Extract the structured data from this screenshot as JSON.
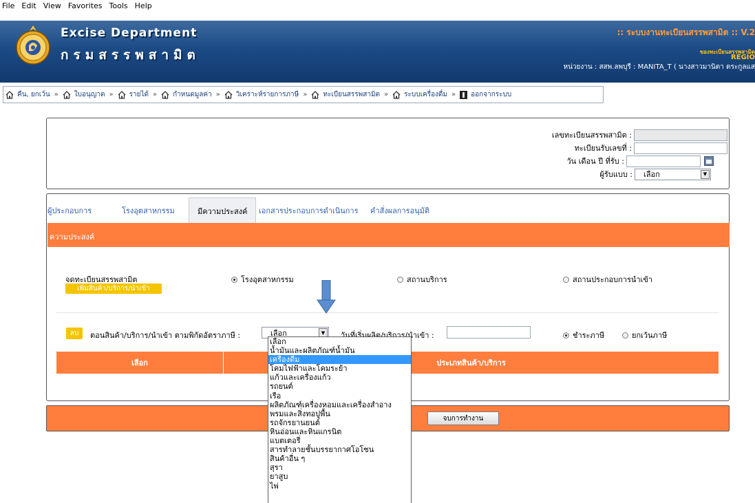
{
  "menubar": {
    "items": [
      "File",
      "Edit",
      "View",
      "Favorites",
      "Tools",
      "Help"
    ]
  },
  "header": {
    "title_en": "Excise Department",
    "title_th": "กรมสรรพสามิต",
    "system_title": ":: ระบบงานทะเบียนสรรพสามิต :: V.2",
    "system_sub": "ของทะเบียนสรรพสามิต",
    "region": "REGIO",
    "unit": "หน่วยงาน : สสพ.ลพบุรี : MANITA_T ( นางสาวมานิตา ตระกูลแส"
  },
  "nav": {
    "items": [
      "คืน, ยกเว้น",
      "ใบอนุญาต",
      "รายได้",
      "กำหนดมูลค่า",
      "วิเคราะห์รายการภาษี",
      "ทะเบียนสรรพสามิต",
      "ระบบเครื่องดื่ม"
    ],
    "exit": "ออกจากระบบ",
    "sep": "»"
  },
  "top_form": {
    "reg_no_label": "เลขทะเบียนสรรพสามิต :",
    "receive_no_label": "ทะเบียนรับเลขที่ :",
    "receive_date_label": "วัน เดือน ปี ที่รับ :",
    "receiver_label": "ผู้รับแบบ :",
    "receiver_value": "เลือก"
  },
  "tabs": [
    "ผู้ประกอบการ",
    "โรงอุตสาหกรรม",
    "มีความประสงค์",
    "เอกสารประกอบการดำเนินการ",
    "คำสั่งผลการอนุมัติ"
  ],
  "section": {
    "title": "ความประสงค์",
    "register_label": "จดทะเบียนสรรพสามิต",
    "add_button": "เพิ่มสินค้า/บริการ/นำเข้า",
    "radios": [
      "โรงอุตสาหกรรม",
      "สถานบริการ",
      "สถานประกอบการนำเข้า"
    ],
    "delete_button": "ลบ",
    "product_label": "ตอนสินค้า/บริการ/นำเข้า ตามพิกัดอัตราภาษี :",
    "product_value": "เลือก",
    "start_date_label": "วันที่เริ่มผลิต/บริการ/นำเข้า :",
    "tax_radios": [
      "ชำระภาษี",
      "ยกเว้นภาษี"
    ],
    "table_headers": [
      "เลือก",
      "ประเภทสินค้า/บริการ"
    ]
  },
  "footer": {
    "finish_button": "จบการทำงาน"
  },
  "dropdown": {
    "options": [
      "เลือก",
      "น้ำมันและผลิตภัณฑ์น้ำมัน",
      "เครื่องดื่ม",
      "โคมไฟฟ้าและโคมระย้า",
      "แก้วและเครื่องแก้ว",
      "รถยนต์",
      "เรือ",
      "ผลิตภัณฑ์เครื่องหอมและเครื่องสำอาง",
      "พรมและสิ่งทอปูพื้น",
      "รถจักรยานยนต์",
      "หินอ่อนและหินแกรนิต",
      "แบตเตอรี่",
      "สารทำลายชั้นบรรยากาศโอโซน",
      "สินค้าอื่น ๆ",
      "สุรา",
      "ยาสูบ",
      "ไพ่"
    ],
    "highlighted": "เครื่องดื่ม"
  },
  "colors": {
    "orange": "#ff7e3e",
    "yellow": "#f5c400",
    "banner": "#1c4a85",
    "highlight": "#3399ff",
    "link": "#3361a8"
  }
}
